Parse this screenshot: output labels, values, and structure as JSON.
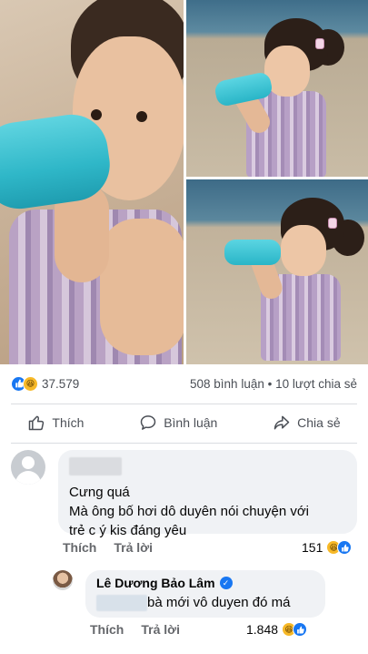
{
  "post": {
    "reactions_count": "37.579",
    "comments_shares": "508 bình luận • 10 lượt chia sẻ",
    "reaction_types": [
      "like",
      "haha"
    ]
  },
  "actions": {
    "like_label": "Thích",
    "comment_label": "Bình luận",
    "share_label": "Chia sẻ"
  },
  "comment1": {
    "text_line1": "Cưng quá",
    "text_line2": "Mà ông bố hơi dô duyên nói chuyện với",
    "text_line3": "trẻ c ý kis đáng yêu",
    "like_label": "Thích",
    "reply_label": "Trả lời",
    "reaction_count": "151"
  },
  "reply1": {
    "author": "Lê Dương Bảo Lâm",
    "text_visible": "bà mới vô duyen đó má",
    "like_label": "Thích",
    "reply_label": "Trả lời",
    "reaction_count": "1.848"
  },
  "colors": {
    "facebook_blue": "#1877f2",
    "haha_yellow": "#f7b928",
    "bubble_gray": "#f0f2f5",
    "meta_gray": "#65676b",
    "bottle_teal": "#2fb7c8"
  }
}
